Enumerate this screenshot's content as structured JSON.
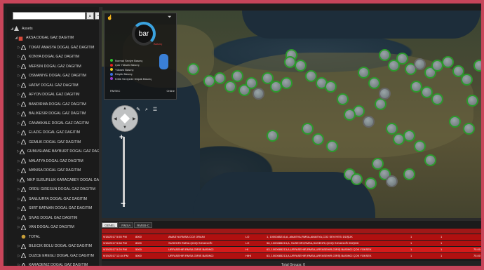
{
  "search": {
    "value": "",
    "search_icon": "search-icon",
    "collapse_icon": "minus-icon"
  },
  "tree": {
    "root_label": "Assets",
    "group_label": "AKSA DOGAL GAZ DAGITIM",
    "items": [
      {
        "label": "TOKAT AMASYA DOGAL GAZ DAGITIM"
      },
      {
        "label": "KONYA DOGAL GAZ DAGITIM"
      },
      {
        "label": "MERSIN DOGAL GAZ DAGITIM"
      },
      {
        "label": "OSMANIYE DOGAL GAZ DAGITIM"
      },
      {
        "label": "HATAY DOGAL GAZ DAGITIM"
      },
      {
        "label": "AFYON DOGAL GAZ DAGITIM"
      },
      {
        "label": "BANDIRMA DOGAL GAZ DAGITIM"
      },
      {
        "label": "BALIKESIR DOGAL GAZ DAGITIM"
      },
      {
        "label": "CANAKKALE DOGAL GAZ DAGITIM"
      },
      {
        "label": "ELAZIG DOGAL GAZ DAGITIM"
      },
      {
        "label": "GEMLIK DOGAL GAZ DAGITIM"
      },
      {
        "label": "GUMUSHANE BAYBURT DOGAL GAZ DAGITIM"
      },
      {
        "label": "MALATYA DOGAL GAZ DAGITIM"
      },
      {
        "label": "MANISA DOGAL GAZ DAGITIM"
      },
      {
        "label": "MKP SUSURLUK KARACABEY DOGAL GAZ DAGITIM"
      },
      {
        "label": "ORDU GIRESUN DOGAL GAZ DAGITIM"
      },
      {
        "label": "SANLIURFA DOGAL GAZ DAGITIM"
      },
      {
        "label": "SIIRT BATMAN DOGAL GAZ DAGITIM"
      },
      {
        "label": "SIVAS DOGAL GAZ DAGITIM"
      },
      {
        "label": "VAN DOGAL GAZ DAGITIM"
      },
      {
        "label": "TOTAL"
      },
      {
        "label": "BILECIK BOLU DOGAL GAZ DAGITIM"
      },
      {
        "label": "DUZCE EREGLI DOGAL GAZ DAGITIM"
      },
      {
        "label": "KARADENIZ DOGAL GAZ DAGITIM"
      }
    ]
  },
  "gauge": {
    "label": "bar",
    "sub_label": "Basınç"
  },
  "legend": {
    "items": [
      {
        "label": "Normal Seviye Basınç",
        "color": "#2fc42f"
      },
      {
        "label": "Çok Yüksek Basınç",
        "color": "#e02020"
      },
      {
        "label": "Yüksek Basınç",
        "color": "#f0d020"
      },
      {
        "label": "Düşük Basınç",
        "color": "#3a6fe0"
      },
      {
        "label": "Kritik Seviyede Düşük Basınç",
        "color": "#9a3ad0"
      }
    ],
    "footer_left": "RMSKC",
    "footer_right": "Online"
  },
  "tabs": [
    {
      "label": "GENEL"
    },
    {
      "label": "RMSA"
    },
    {
      "label": "RMSB-C"
    }
  ],
  "alarms": [
    {
      "time": "9/18/2017 5:55 PM",
      "code": "8000",
      "desc": "AMASYA RMSA CO2 ORANI",
      "type": "LO",
      "detail": "1, 1000085216,A, AMASYA,RMSA,AMASYA,CO2 SEVIYESI DÜŞÜK",
      "c1": "1",
      "c2": "1",
      "val": ""
    },
    {
      "time": "9/18/2017 5:58 PM",
      "code": "8000",
      "desc": "SUSEHRI RMSA ÇIKIŞ SICAKLIĞI",
      "type": "LO",
      "detail": "58, 1000085213,A, SUSEHRI,RMSA,SUSEHRI,ÇIKIŞ SICAKLIĞI DÜŞÜK",
      "c1": "1",
      "c2": "1",
      "val": ""
    },
    {
      "time": "9/19/2017 5:29 PM",
      "code": "5000",
      "desc": "URFASEHIR RMSA GIRIS BASINCI",
      "type": "HI",
      "detail": "63, 1000085213,A,URFASEHIR,RMSA,URFASEHIR,GİRİŞ BASINCI ÇOK YÜKSEK",
      "c1": "1",
      "c2": "1",
      "val": "75.00"
    },
    {
      "time": "9/19/2017 12:44 PM",
      "code": "5000",
      "desc": "URFASEHIR RMSA GIRIS BASINCI",
      "type": "HIHI",
      "detail": "63, 1000085213,A,URFASEHIR,RMSA,URFASEHIR,GİRİŞ BASINCI ÇOK YÜKSEK",
      "c1": "1",
      "c2": "1",
      "val": "75.00"
    }
  ],
  "footer": {
    "total_groups": "Total Groups: 0"
  },
  "colors": {
    "frame": "#c8455a",
    "alarm_row": "#b01010",
    "alarm_row_bright": "#d41a1a",
    "cluster_ring": "#2c9a2c"
  }
}
